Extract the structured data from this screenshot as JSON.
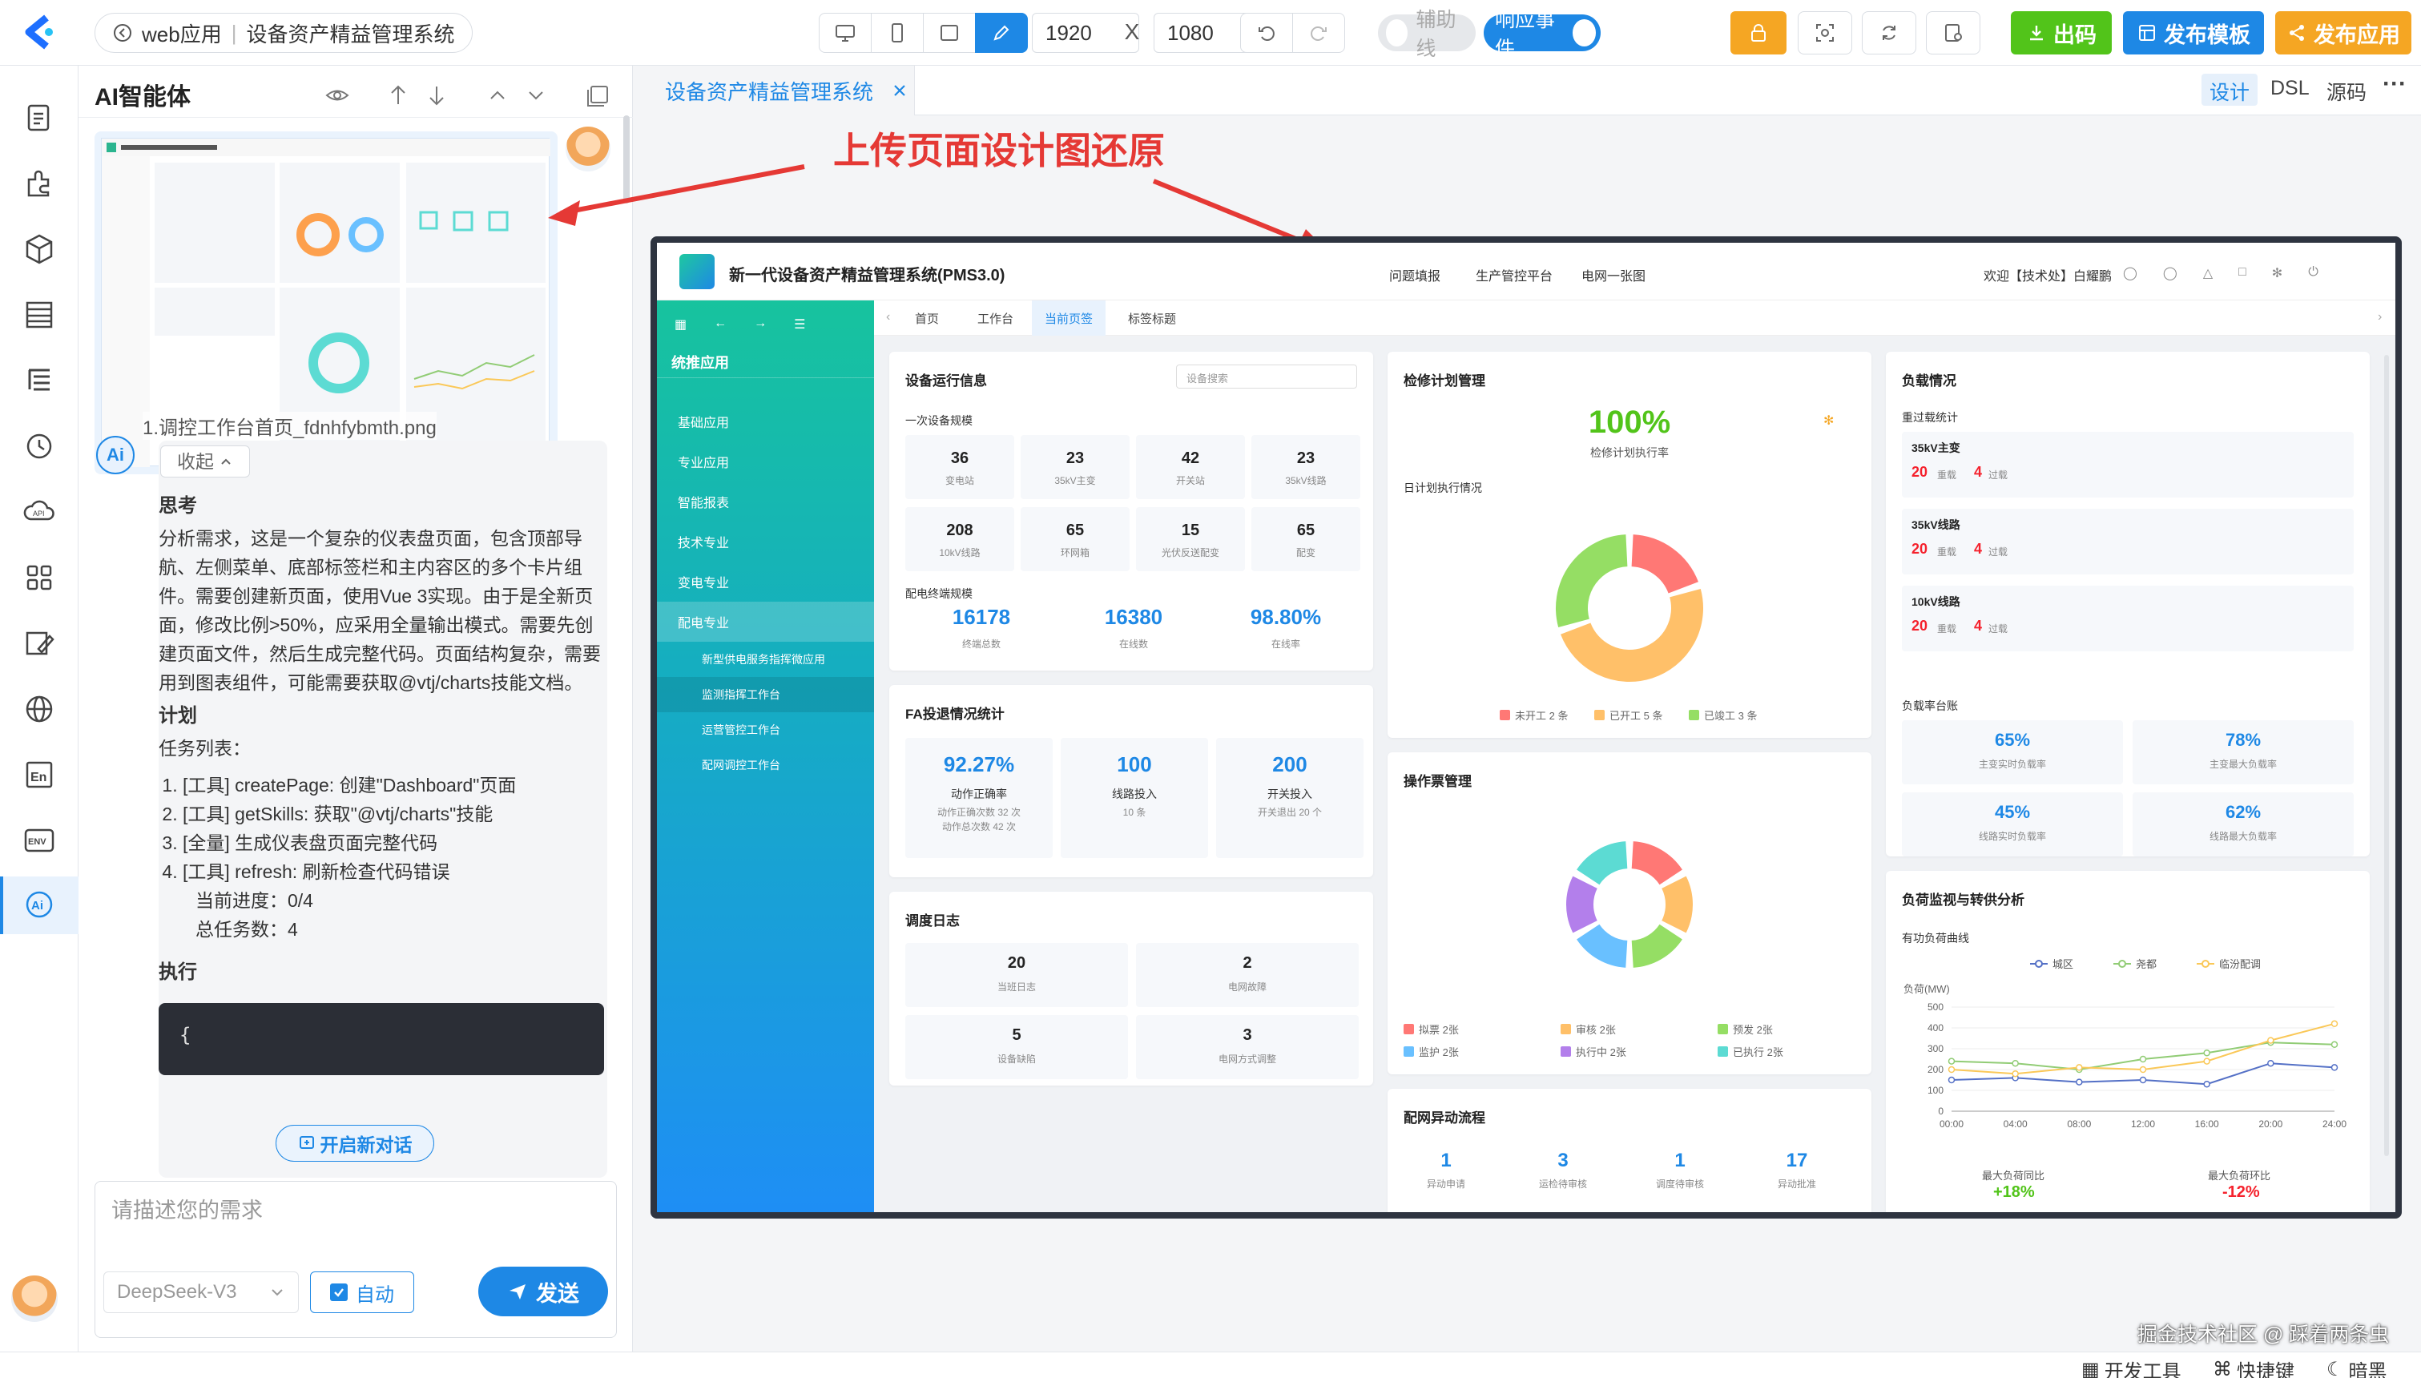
{
  "toolbar": {
    "app": "web应用",
    "project": "设备资产精益管理系统",
    "width": "1920",
    "height": "1080",
    "times": "X",
    "guide_label": "辅助线",
    "events_label": "响应事件",
    "export_label": "出码",
    "template_label": "发布模板",
    "publish_label": "发布应用",
    "colors": {
      "export": "#52c41a",
      "template": "#1e88e5",
      "publish": "#f5a623",
      "lock": "#f5a623"
    }
  },
  "ai_panel": {
    "title": "AI智能体",
    "attachment_name": "1.调控工作台首页_fdnhfybmth.png",
    "collapse_label": "收起",
    "think_heading": "思考",
    "think_text": "分析需求，这是一个复杂的仪表盘页面，包含顶部导航、左侧菜单、底部标签栏和主内容区的多个卡片组件。需要创建新页面，使用Vue 3实现。由于是全新页面，修改比例>50%，应采用全量输出模式。需要先创建页面文件，然后生成完整代码。页面结构复杂，需要用到图表组件，可能需要获取@vtj/charts技能文档。",
    "plan_heading": "计划",
    "task_list_label": "任务列表：",
    "tasks": [
      "[工具] createPage: 创建\"Dashboard\"页面",
      "[工具] getSkills: 获取\"@vtj/charts\"技能",
      "[全量] 生成仪表盘页面完整代码",
      "[工具] refresh: 刷新检查代码错误"
    ],
    "progress": "当前进度：0/4",
    "total": "总任务数：4",
    "exec_heading": "执行",
    "code_start": "{",
    "new_chat": "开启新对话",
    "input_placeholder": "请描述您的需求",
    "model": "DeepSeek-V3",
    "auto_label": "自动",
    "send_label": "发送"
  },
  "designer": {
    "tab_title": "设备资产精益管理系统",
    "views": [
      "设计",
      "DSL",
      "源码"
    ],
    "more": "···",
    "annotation": "上传页面设计图还原"
  },
  "pms": {
    "title": "新一代设备资产精益管理系统(PMS3.0)",
    "nav": [
      "问题填报",
      "生产管控平台",
      "电网一张图"
    ],
    "welcome": "欢迎【技术处】白耀鹏",
    "side_title": "统推应用",
    "side_items": [
      "基础应用",
      "专业应用",
      "智能报表",
      "技术专业",
      "变电专业",
      "配电专业"
    ],
    "sub_items": [
      "新型供电服务指挥微应用",
      "监测指挥工作台",
      "运营管控工作台",
      "配网调控工作台"
    ],
    "tabs": [
      "首页",
      "工作台",
      "当前页签",
      "标签标题"
    ],
    "device": {
      "title": "设备运行信息",
      "search_placeholder": "设备搜索",
      "section1": "一次设备规模",
      "stats": [
        {
          "v": "36",
          "l": "变电站"
        },
        {
          "v": "23",
          "l": "35kV主变"
        },
        {
          "v": "42",
          "l": "开关站"
        },
        {
          "v": "23",
          "l": "35kV线路"
        },
        {
          "v": "208",
          "l": "10kV线路"
        },
        {
          "v": "65",
          "l": "环网箱"
        },
        {
          "v": "15",
          "l": "光伏反送配变"
        },
        {
          "v": "65",
          "l": "配变"
        }
      ],
      "section2": "配电终端规模",
      "terminal": [
        {
          "v": "16178",
          "l": "终端总数"
        },
        {
          "v": "16380",
          "l": "在线数"
        },
        {
          "v": "98.80%",
          "l": "在线率"
        }
      ]
    },
    "fa": {
      "title": "FA投退情况统计",
      "items": [
        {
          "v": "92.27%",
          "l": "动作正确率",
          "s1": "动作正确次数 32 次",
          "s2": "动作总次数 42 次"
        },
        {
          "v": "100",
          "l": "线路投入",
          "s1": "10 条",
          "s2": ""
        },
        {
          "v": "200",
          "l": "开关投入",
          "s1": "开关退出 20 个",
          "s2": ""
        }
      ]
    },
    "dispatch": {
      "title": "调度日志",
      "items": [
        {
          "v": "20",
          "l": "当班日志"
        },
        {
          "v": "2",
          "l": "电网故障"
        },
        {
          "v": "5",
          "l": "设备缺陷"
        },
        {
          "v": "3",
          "l": "电网方式调整"
        }
      ]
    },
    "maint": {
      "title": "检修计划管理",
      "rate": "100%",
      "rate_label": "检修计划执行率",
      "daily": "日计划执行情况",
      "legend": [
        {
          "name": "未开工 2 条",
          "color": "#ff7875"
        },
        {
          "name": "已开工 5 条",
          "color": "#ffc069"
        },
        {
          "name": "已竣工 3 条",
          "color": "#95de64"
        }
      ]
    },
    "ops": {
      "title": "操作票管理",
      "legend": [
        {
          "name": "拟票 2张",
          "color": "#ff7875"
        },
        {
          "name": "审核 2张",
          "color": "#ffc069"
        },
        {
          "name": "预发 2张",
          "color": "#95de64"
        },
        {
          "name": "监护 2张",
          "color": "#69c0ff"
        },
        {
          "name": "执行中 2张",
          "color": "#b37feb"
        },
        {
          "name": "已执行 2张",
          "color": "#5cdbd3"
        }
      ]
    },
    "abnormal": {
      "title": "配网异动流程",
      "items": [
        {
          "v": "1",
          "l": "异动申请"
        },
        {
          "v": "3",
          "l": "运检待审核"
        },
        {
          "v": "1",
          "l": "调度待审核"
        },
        {
          "v": "17",
          "l": "异动批准"
        }
      ]
    },
    "load": {
      "title": "负载情况",
      "overload": "重过载统计",
      "items": [
        {
          "name": "35kV主变",
          "a": "20",
          "al": "重载",
          "b": "4",
          "bl": "过载"
        },
        {
          "name": "35kV线路",
          "a": "20",
          "al": "重载",
          "b": "4",
          "bl": "过载"
        },
        {
          "name": "10kV线路",
          "a": "20",
          "al": "重载",
          "b": "4",
          "bl": "过载"
        }
      ],
      "rate_title": "负载率台账",
      "rates": [
        {
          "v": "65%",
          "l": "主变实时负载率"
        },
        {
          "v": "78%",
          "l": "主变最大负载率"
        },
        {
          "v": "45%",
          "l": "线路实时负载率"
        },
        {
          "v": "62%",
          "l": "线路最大负载率"
        }
      ]
    },
    "monitor": {
      "title": "负荷监视与转供分析",
      "curve": "有功负荷曲线",
      "yoy_label": "最大负荷同比",
      "yoy": "+18%",
      "mom_label": "最大负荷环比",
      "mom": "-12%"
    }
  },
  "chart_data": {
    "type": "line",
    "x": [
      "00:00",
      "04:00",
      "08:00",
      "12:00",
      "16:00",
      "20:00",
      "24:00"
    ],
    "ylabel": "负荷(MW)",
    "ylim": [
      0,
      500
    ],
    "yticks": [
      "500",
      "400",
      "300",
      "200",
      "100",
      "0"
    ],
    "series": [
      {
        "name": "城区",
        "color": "#5470c6",
        "values": [
          150,
          160,
          140,
          150,
          130,
          230,
          210
        ]
      },
      {
        "name": "尧都",
        "color": "#91cc75",
        "values": [
          240,
          230,
          200,
          250,
          280,
          330,
          320
        ]
      },
      {
        "name": "临汾配调",
        "color": "#fac858",
        "values": [
          200,
          180,
          210,
          200,
          240,
          340,
          420
        ]
      }
    ]
  },
  "footer": {
    "dev_tools": "开发工具",
    "shortcuts": "快捷键",
    "theme": "暗黑",
    "watermark": "掘金技术社区 @ 踩着两条虫"
  }
}
